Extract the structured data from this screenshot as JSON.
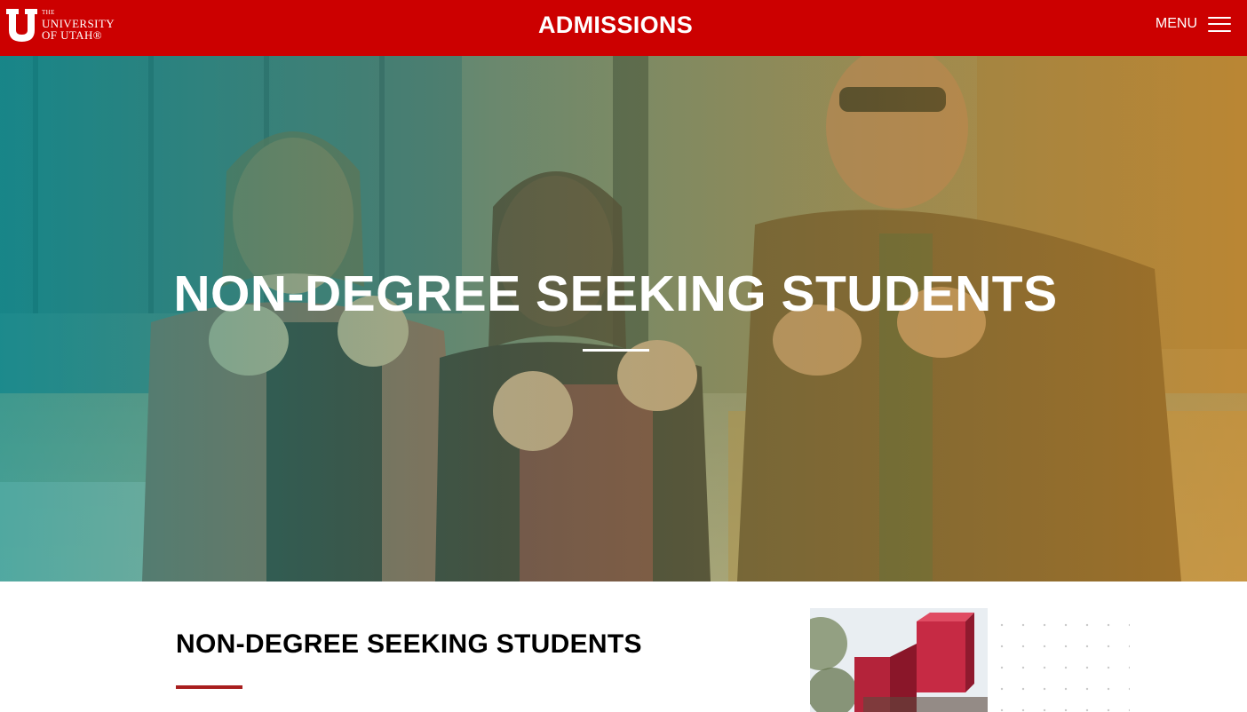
{
  "header": {
    "logo": {
      "the": "THE",
      "line1": "UNIVERSITY",
      "line2": "OF UTAH®"
    },
    "title": "ADMISSIONS",
    "menu_label": "MENU",
    "background_color": "#cc0000"
  },
  "hero": {
    "title": "NON-DEGREE SEEKING STUDENTS",
    "image": "three students making the U hand sign on campus"
  },
  "content": {
    "title": "NON-DEGREE SEEKING STUDENTS",
    "accent_color": "#a81e1e",
    "side_image": "red block U sculpture on campus"
  },
  "icons": {
    "logo": "block-u-logo-icon",
    "menu": "hamburger-menu-icon"
  }
}
